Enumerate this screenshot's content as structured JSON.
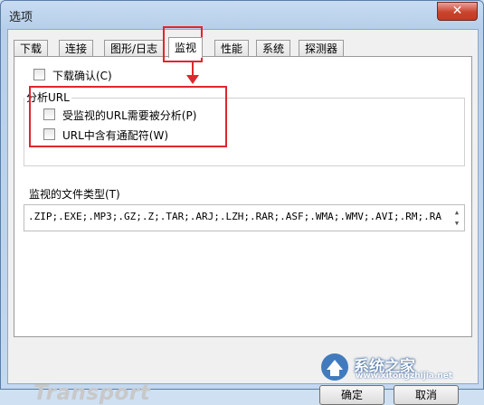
{
  "window": {
    "title": "选项",
    "close_label": "✕"
  },
  "tabs": [
    {
      "label": "下载",
      "active": false
    },
    {
      "label": "连接",
      "active": false
    },
    {
      "label": "图形/日志",
      "active": false
    },
    {
      "label": "监视",
      "active": true
    },
    {
      "label": "性能",
      "active": false
    },
    {
      "label": "系统",
      "active": false
    },
    {
      "label": "探测器",
      "active": false
    }
  ],
  "panel": {
    "download_confirm": {
      "label": "下载确认(C)",
      "checked": false
    },
    "analyze_group": {
      "title": "分析URL",
      "items": [
        {
          "label": "受监视的URL需要被分析(P)",
          "checked": false
        },
        {
          "label": "URL中含有通配符(W)",
          "checked": false
        }
      ]
    },
    "file_types": {
      "label": "监视的文件类型(T)",
      "value": ".ZIP;.EXE;.MP3;.GZ;.Z;.TAR;.ARJ;.LZH;.RAR;.ASF;.WMA;.WMV;.AVI;.RM;.RA"
    }
  },
  "footer": {
    "brand": "Transport",
    "ok_label": "确定",
    "cancel_label": "取消"
  },
  "watermark": {
    "text": "系统之家",
    "url": "www.xitongzhijia.net"
  },
  "colors": {
    "highlight": "#e0262e",
    "accent": "#2f6fb8"
  }
}
